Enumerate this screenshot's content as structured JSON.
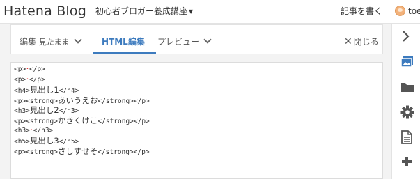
{
  "header": {
    "logo": "Hatena Blog",
    "blog_selector": "初心者ブロガー養成講座",
    "write_article": "記事を書く",
    "username": "toe"
  },
  "editor_tabs": {
    "edit_mode_label": "編集",
    "edit_mode_value": "見たまま",
    "html_edit": "HTML編集",
    "preview": "プレビュー",
    "close": "閉じる"
  },
  "editor": {
    "lines": [
      {
        "pre": "<p>",
        "mid": "･",
        "post": "</p>"
      },
      {
        "pre": "<p>",
        "mid": "･",
        "post": "</p>"
      },
      {
        "pre": "<h4>",
        "mid": "見出し1",
        "post": "</h4>"
      },
      {
        "pre": "<p><strong>",
        "mid": "あいうえお",
        "post": "</strong></p>"
      },
      {
        "pre": "<h3>",
        "mid": "見出し2",
        "post": "</h3>"
      },
      {
        "pre": "<p><strong>",
        "mid": "かきくけこ",
        "post": "</strong></p>"
      },
      {
        "pre": "<h3>",
        "mid": "･",
        "post": "</h3>"
      },
      {
        "pre": "<h5>",
        "mid": "見出し3",
        "post": "</h5>"
      },
      {
        "pre": "<p><strong>",
        "mid": "さしすせそ",
        "post": "</strong></p>"
      }
    ]
  },
  "sidebar": {
    "icons": [
      "chevron-right-icon",
      "photo-icon",
      "folder-icon",
      "gear-icon",
      "document-icon",
      "plus-icon"
    ]
  },
  "colors": {
    "accent": "#3d7bbe",
    "background": "#f3f3f3"
  }
}
